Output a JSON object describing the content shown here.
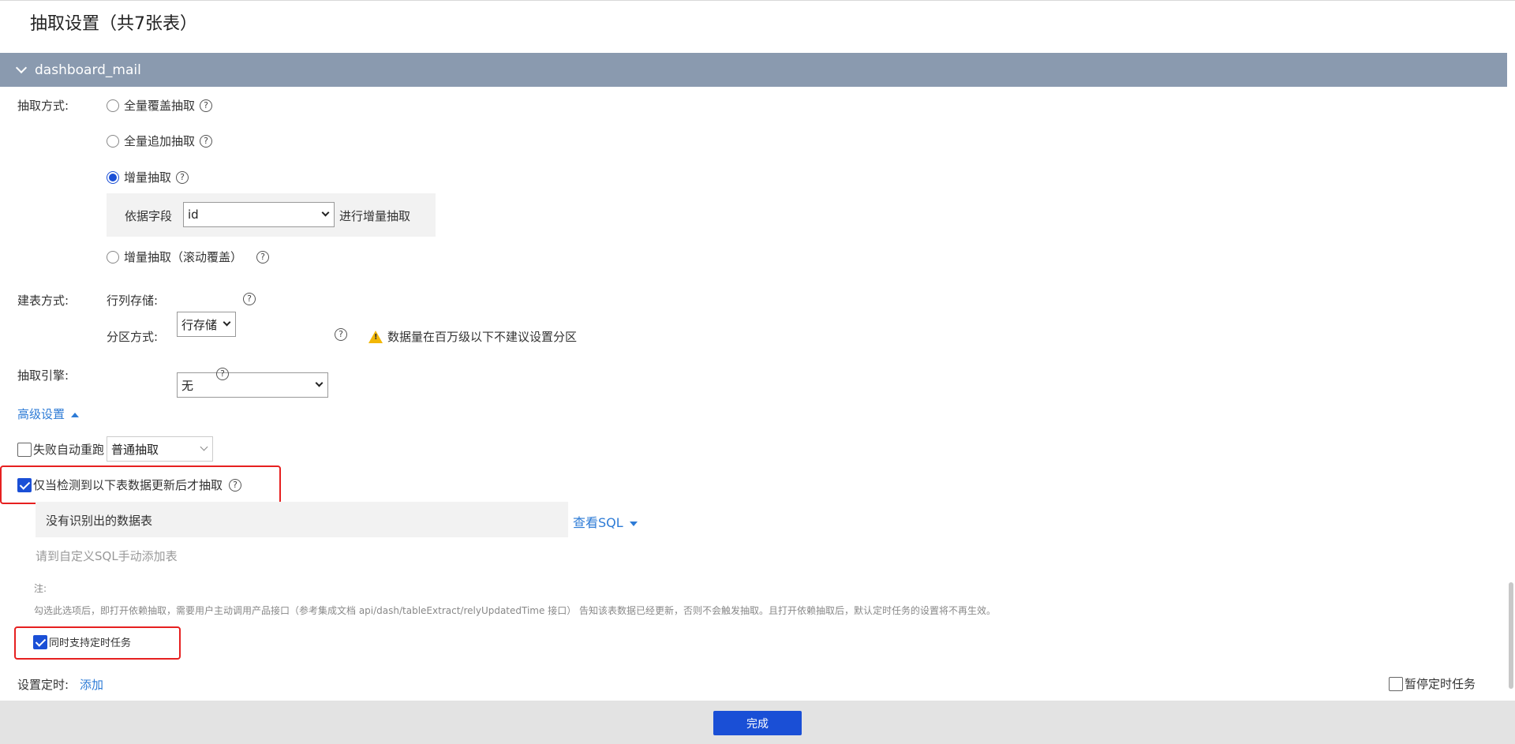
{
  "page": {
    "title": "抽取设置（共7张表）"
  },
  "section": {
    "name": "dashboard_mail"
  },
  "extract_mode": {
    "label": "抽取方式:",
    "options": [
      "全量覆盖抽取",
      "全量追加抽取",
      "增量抽取",
      "增量抽取（滚动覆盖）"
    ],
    "selected_index": 2,
    "incremental": {
      "prefix": "依据字段",
      "field_value": "id",
      "suffix": "进行增量抽取"
    }
  },
  "table_mode": {
    "label": "建表方式:",
    "storage_label": "行列存储:",
    "storage_value": "行存储",
    "partition_label": "分区方式:",
    "partition_value": "无",
    "partition_warning": "数据量在百万级以下不建议设置分区"
  },
  "engine": {
    "label": "抽取引擎:",
    "value": "普通抽取"
  },
  "advanced": {
    "toggle_label": "高级设置",
    "fail_retry_label": "失败自动重跑",
    "fail_retry_checked": false,
    "only_on_update_label": "仅当检测到以下表数据更新后才抽取",
    "only_on_update_checked": true,
    "no_tables_text": "没有识别出的数据表",
    "view_sql_label": "查看SQL",
    "custom_sql_hint": "请到自定义SQL手动添加表",
    "note_title": "注:",
    "note_text": "勾选此选项后，即打开依赖抽取，需要用户主动调用产品接口（参考集成文档 api/dash/tableExtract/relyUpdatedTime 接口） 告知该表数据已经更新，否则不会触发抽取。且打开依赖抽取后，默认定时任务的设置将不再生效。",
    "also_schedule_label": "同时支持定时任务",
    "also_schedule_checked": true
  },
  "schedule": {
    "label": "设置定时:",
    "add_label": "添加",
    "pause_label": "暂停定时任务",
    "pause_checked": false
  },
  "footer": {
    "done_label": "完成"
  },
  "icons": {
    "help": "?",
    "collapse": "chevron-down-icon",
    "warning": "warning-icon"
  },
  "colors": {
    "accent": "#1a4fd6",
    "link": "#2d7bd6",
    "header_bg": "#8a9aaf",
    "highlight": "#e62020"
  }
}
